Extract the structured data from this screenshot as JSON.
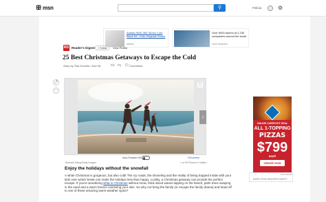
{
  "header": {
    "logo": "msn",
    "user_name": "Felicia",
    "search_placeholder": ""
  },
  "promos": [
    {
      "title": "Adidas NMD 360 Shoes Core Black Kit - Kids Originals Shoes",
      "source": "adidas"
    },
    {
      "title": "Over 6000 alumni at 2,230 companies around the world",
      "source": "Hunt Networks"
    }
  ],
  "publisher": {
    "logo_text": "RD",
    "name": "Reader's Digest",
    "follow_label": "+ Follow",
    "view_profile_label": "View Profile"
  },
  "article": {
    "title": "25 Best Christmas Getaways to Escape the Cold",
    "byline": "Story by Tina Donvito • Nov 28",
    "comments_label": "Comments"
  },
  "gallery": {
    "autorotate_label": "Auto-Rotation Off",
    "fullscreen_label": "Full screen",
    "credit": "Shmarle Klang/Getty Images",
    "counter": "1 of 26 Photos in Gallery"
  },
  "section": {
    "heading": "Enjoy the holidays without the snowfall",
    "body_pre": "A white Christmas is gorgeous, but also cold! The icy roads, the shoveling and the reality of being trapped inside with your kids over winter break can make the holidays less than happy. Luckily, a Christmas getaway can provide the perfect escape. If you're wondering ",
    "body_link": "what is Christmas",
    "body_post": " without snow, think about waves lapping on the beach, palm trees swaying in the sand and a warm breeze caressing your skin. So why not bring the family (or escape the family drama) and head off to one of these amazing warm-weather spots?"
  },
  "ad": {
    "line1": "ONLINE CARRYOUT DEAL",
    "line2": "ALL 1-TOPPING",
    "line3": "PIZZAS",
    "price": "$799",
    "each": "each",
    "order_label": "ORDER NOW",
    "tag": "Ad feedback",
    "footer_text": "MORE FROM READER'S DIGEST"
  },
  "colors": {
    "search_button": "#1a78d6",
    "publisher_red": "#d21f1f",
    "ad_red": "#c8232c",
    "link_blue": "#1a56a8"
  }
}
